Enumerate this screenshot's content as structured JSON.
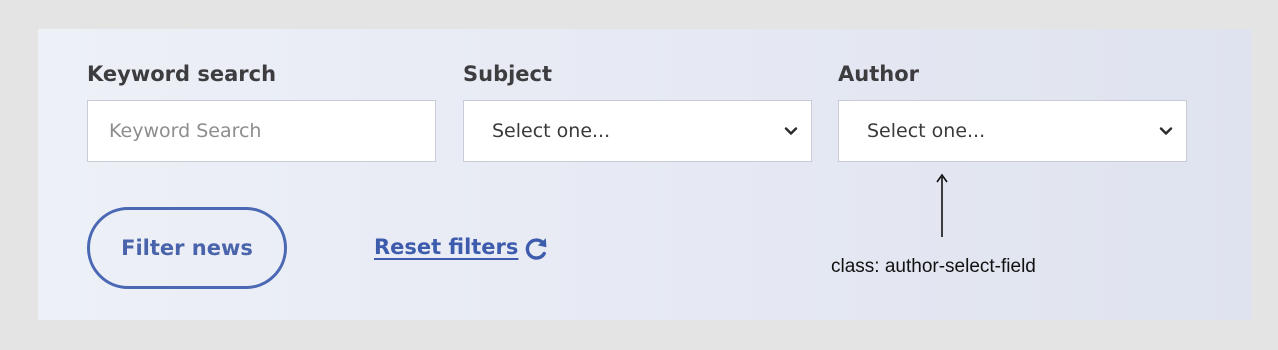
{
  "filters": {
    "keyword": {
      "label": "Keyword search",
      "placeholder": "Keyword Search",
      "value": ""
    },
    "subject": {
      "label": "Subject",
      "selected": "Select one..."
    },
    "author": {
      "label": "Author",
      "selected": "Select one..."
    }
  },
  "actions": {
    "filter_label": "Filter news",
    "reset_label": "Reset filters"
  },
  "annotation": {
    "text": "class: author-select-field"
  },
  "icons": {
    "select_chevron": "chevron-down-icon",
    "reset": "refresh-icon",
    "annotation_arrow": "arrow-up-icon"
  },
  "colors": {
    "accent": "#4a68b3",
    "label_text": "#3d3d3f",
    "page_background": "#e4e4e4",
    "panel_background": "#e8ebf4"
  }
}
